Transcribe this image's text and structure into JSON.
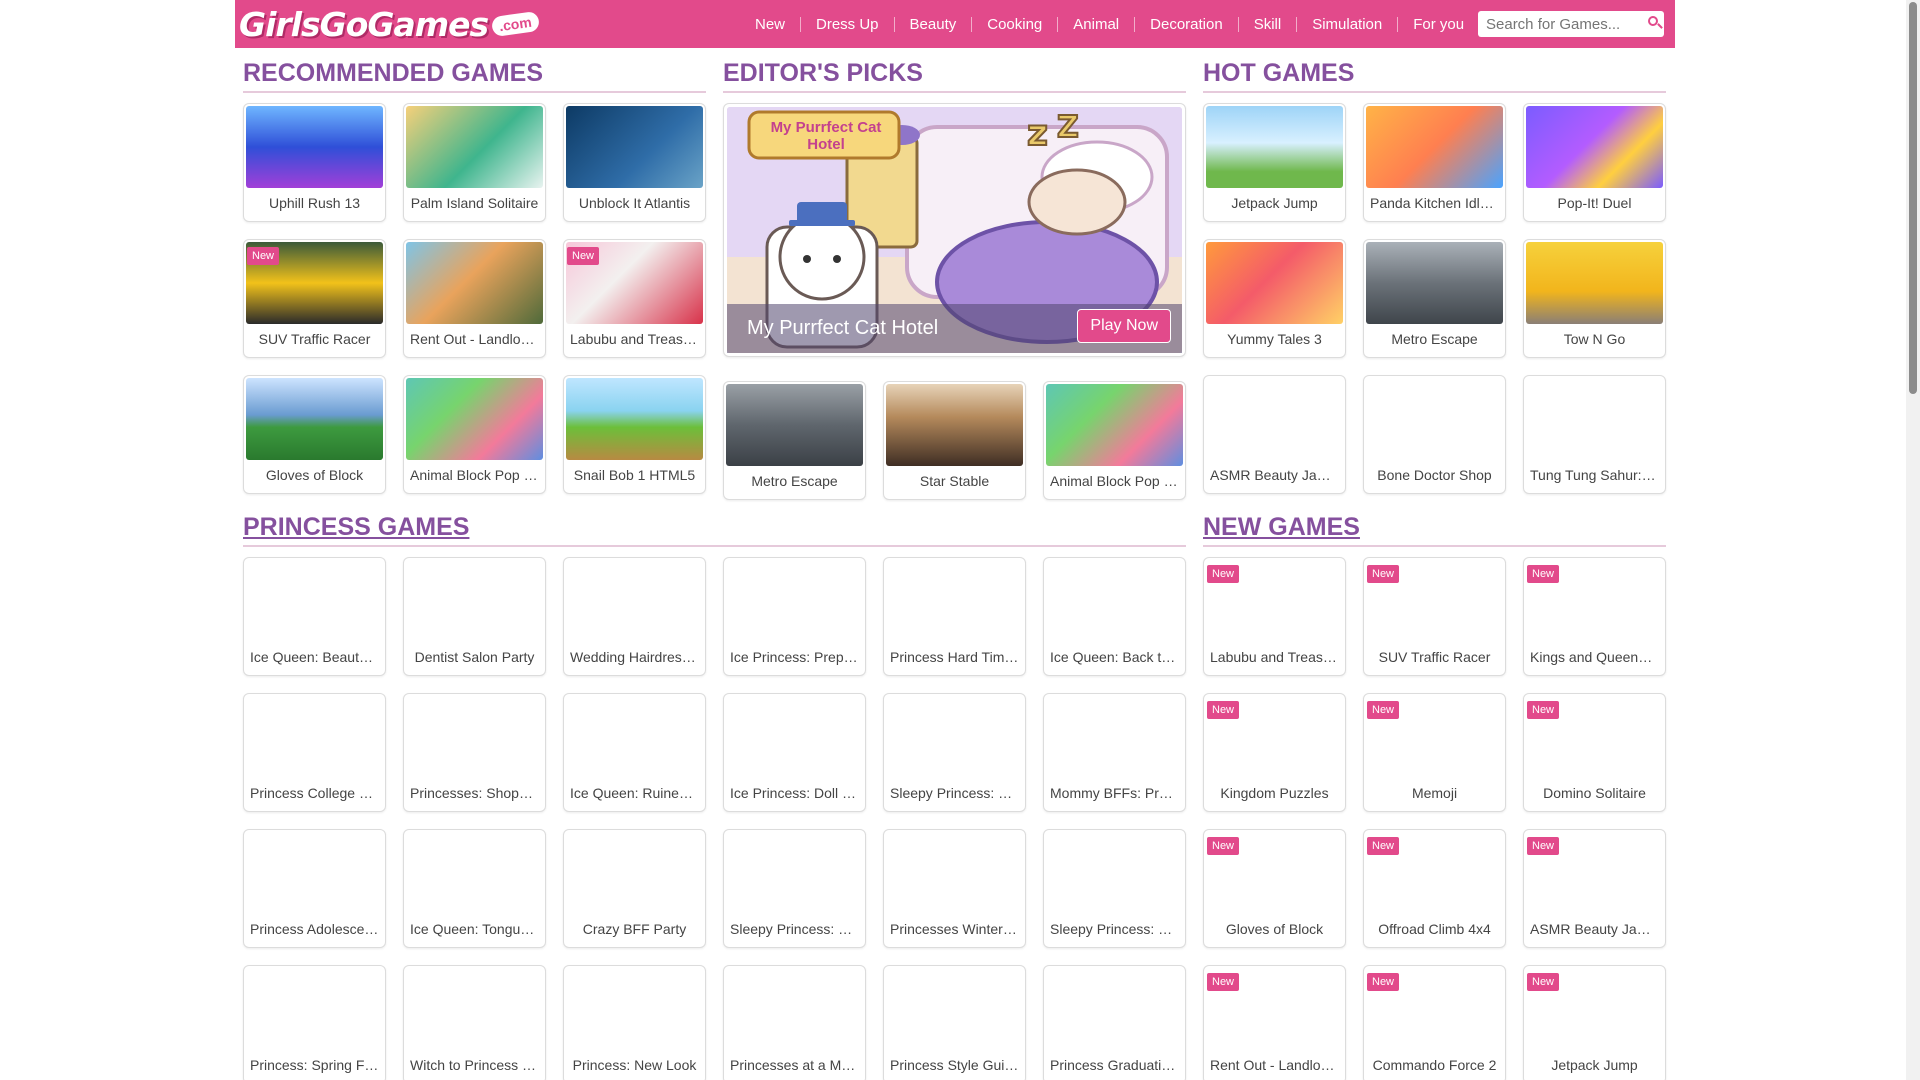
{
  "site": {
    "logo_text": "GirlsGoGames",
    "logo_suffix": ".com"
  },
  "nav": [
    "New",
    "Dress Up",
    "Beauty",
    "Cooking",
    "Animal",
    "Decoration",
    "Skill",
    "Simulation",
    "For you"
  ],
  "search": {
    "placeholder": "Search for Games..."
  },
  "colors": {
    "brand_pink": "#e24a8b",
    "section_purple": "#85509e"
  },
  "recommended": {
    "title": "RECOMMENDED GAMES",
    "games": [
      {
        "label": "Uphill Rush 13",
        "new": false
      },
      {
        "label": "Palm Island Solitaire",
        "new": false
      },
      {
        "label": "Unblock It Atlantis",
        "new": false
      },
      {
        "label": "SUV Traffic Racer",
        "new": true
      },
      {
        "label": "Rent Out - Landlord Tycoon",
        "new": false
      },
      {
        "label": "Labubu and Treasures",
        "new": true
      },
      {
        "label": "Gloves of Block",
        "new": false
      },
      {
        "label": "Animal Block Pop Puzzle",
        "new": false
      },
      {
        "label": "Snail Bob 1 HTML5",
        "new": false
      }
    ]
  },
  "editors": {
    "title": "EDITOR'S PICKS",
    "featured": {
      "title": "My Purrfect Cat Hotel",
      "button": "Play Now",
      "logo_text": "My Purrfect Cat Hotel"
    },
    "games": [
      {
        "label": "Metro Escape",
        "new": false
      },
      {
        "label": "Star Stable",
        "new": false
      },
      {
        "label": "Animal Block Pop Puzzle",
        "new": false
      }
    ]
  },
  "hot": {
    "title": "HOT GAMES",
    "games": [
      {
        "label": "Jetpack Jump",
        "new": false
      },
      {
        "label": "Panda Kitchen Idle Tycoon",
        "new": false
      },
      {
        "label": "Pop-It! Duel",
        "new": false
      },
      {
        "label": "Yummy Tales 3",
        "new": false
      },
      {
        "label": "Metro Escape",
        "new": false
      },
      {
        "label": "Tow N Go",
        "new": false
      },
      {
        "label": "ASMR Beauty Jam Makeover",
        "new": false
      },
      {
        "label": "Bone Doctor Shop",
        "new": false
      },
      {
        "label": "Tung Tung Sahur: Obby",
        "new": false
      }
    ]
  },
  "princess": {
    "title": "PRINCESS GAMES",
    "games": [
      {
        "label": "Ice Queen: Beauty Salon",
        "new": false
      },
      {
        "label": "Dentist Salon Party",
        "new": false
      },
      {
        "label": "Wedding Hairdresser",
        "new": false
      },
      {
        "label": "Ice Princess: Prepare",
        "new": false
      },
      {
        "label": "Princess Hard Times",
        "new": false
      },
      {
        "label": "Ice Queen: Back to School",
        "new": false
      },
      {
        "label": "Princess College Makeover",
        "new": false
      },
      {
        "label": "Princesses: Shopping Rivals",
        "new": false
      },
      {
        "label": "Ice Queen: Ruined Wedding",
        "new": false
      },
      {
        "label": "Ice Princess: Doll House",
        "new": false
      },
      {
        "label": "Sleepy Princess: Spa Day",
        "new": false
      },
      {
        "label": "Mommy BFFs: Pregnant",
        "new": false
      },
      {
        "label": "Princess Adolescence",
        "new": false
      },
      {
        "label": "Ice Queen: Tongue Doctor",
        "new": false
      },
      {
        "label": "Crazy BFF Party",
        "new": false
      },
      {
        "label": "Sleepy Princess: Dress Up",
        "new": false
      },
      {
        "label": "Princesses Winter Fashion",
        "new": false
      },
      {
        "label": "Sleepy Princess: Makeover",
        "new": false
      },
      {
        "label": "Princess: Spring Fashion",
        "new": false
      },
      {
        "label": "Witch to Princess Makeover",
        "new": false
      },
      {
        "label": "Princess: New Look",
        "new": false
      },
      {
        "label": "Princesses at a Masquerade",
        "new": false
      },
      {
        "label": "Princess Style Guide",
        "new": false
      },
      {
        "label": "Princess Graduation Party",
        "new": false
      }
    ]
  },
  "newgames": {
    "title": "NEW GAMES",
    "badge": "New",
    "games": [
      {
        "label": "Labubu and Treasures",
        "new": true
      },
      {
        "label": "SUV Traffic Racer",
        "new": true
      },
      {
        "label": "Kings and Queens Solitaire",
        "new": true
      },
      {
        "label": "Kingdom Puzzles",
        "new": true
      },
      {
        "label": "Memoji",
        "new": true
      },
      {
        "label": "Domino Solitaire",
        "new": true
      },
      {
        "label": "Gloves of Block",
        "new": true
      },
      {
        "label": "Offroad Climb 4x4",
        "new": true
      },
      {
        "label": "ASMR Beauty Jam Makeover",
        "new": true
      },
      {
        "label": "Rent Out - Landlord Tycoon",
        "new": true
      },
      {
        "label": "Commando Force 2",
        "new": true
      },
      {
        "label": "Jetpack Jump",
        "new": true
      }
    ]
  }
}
